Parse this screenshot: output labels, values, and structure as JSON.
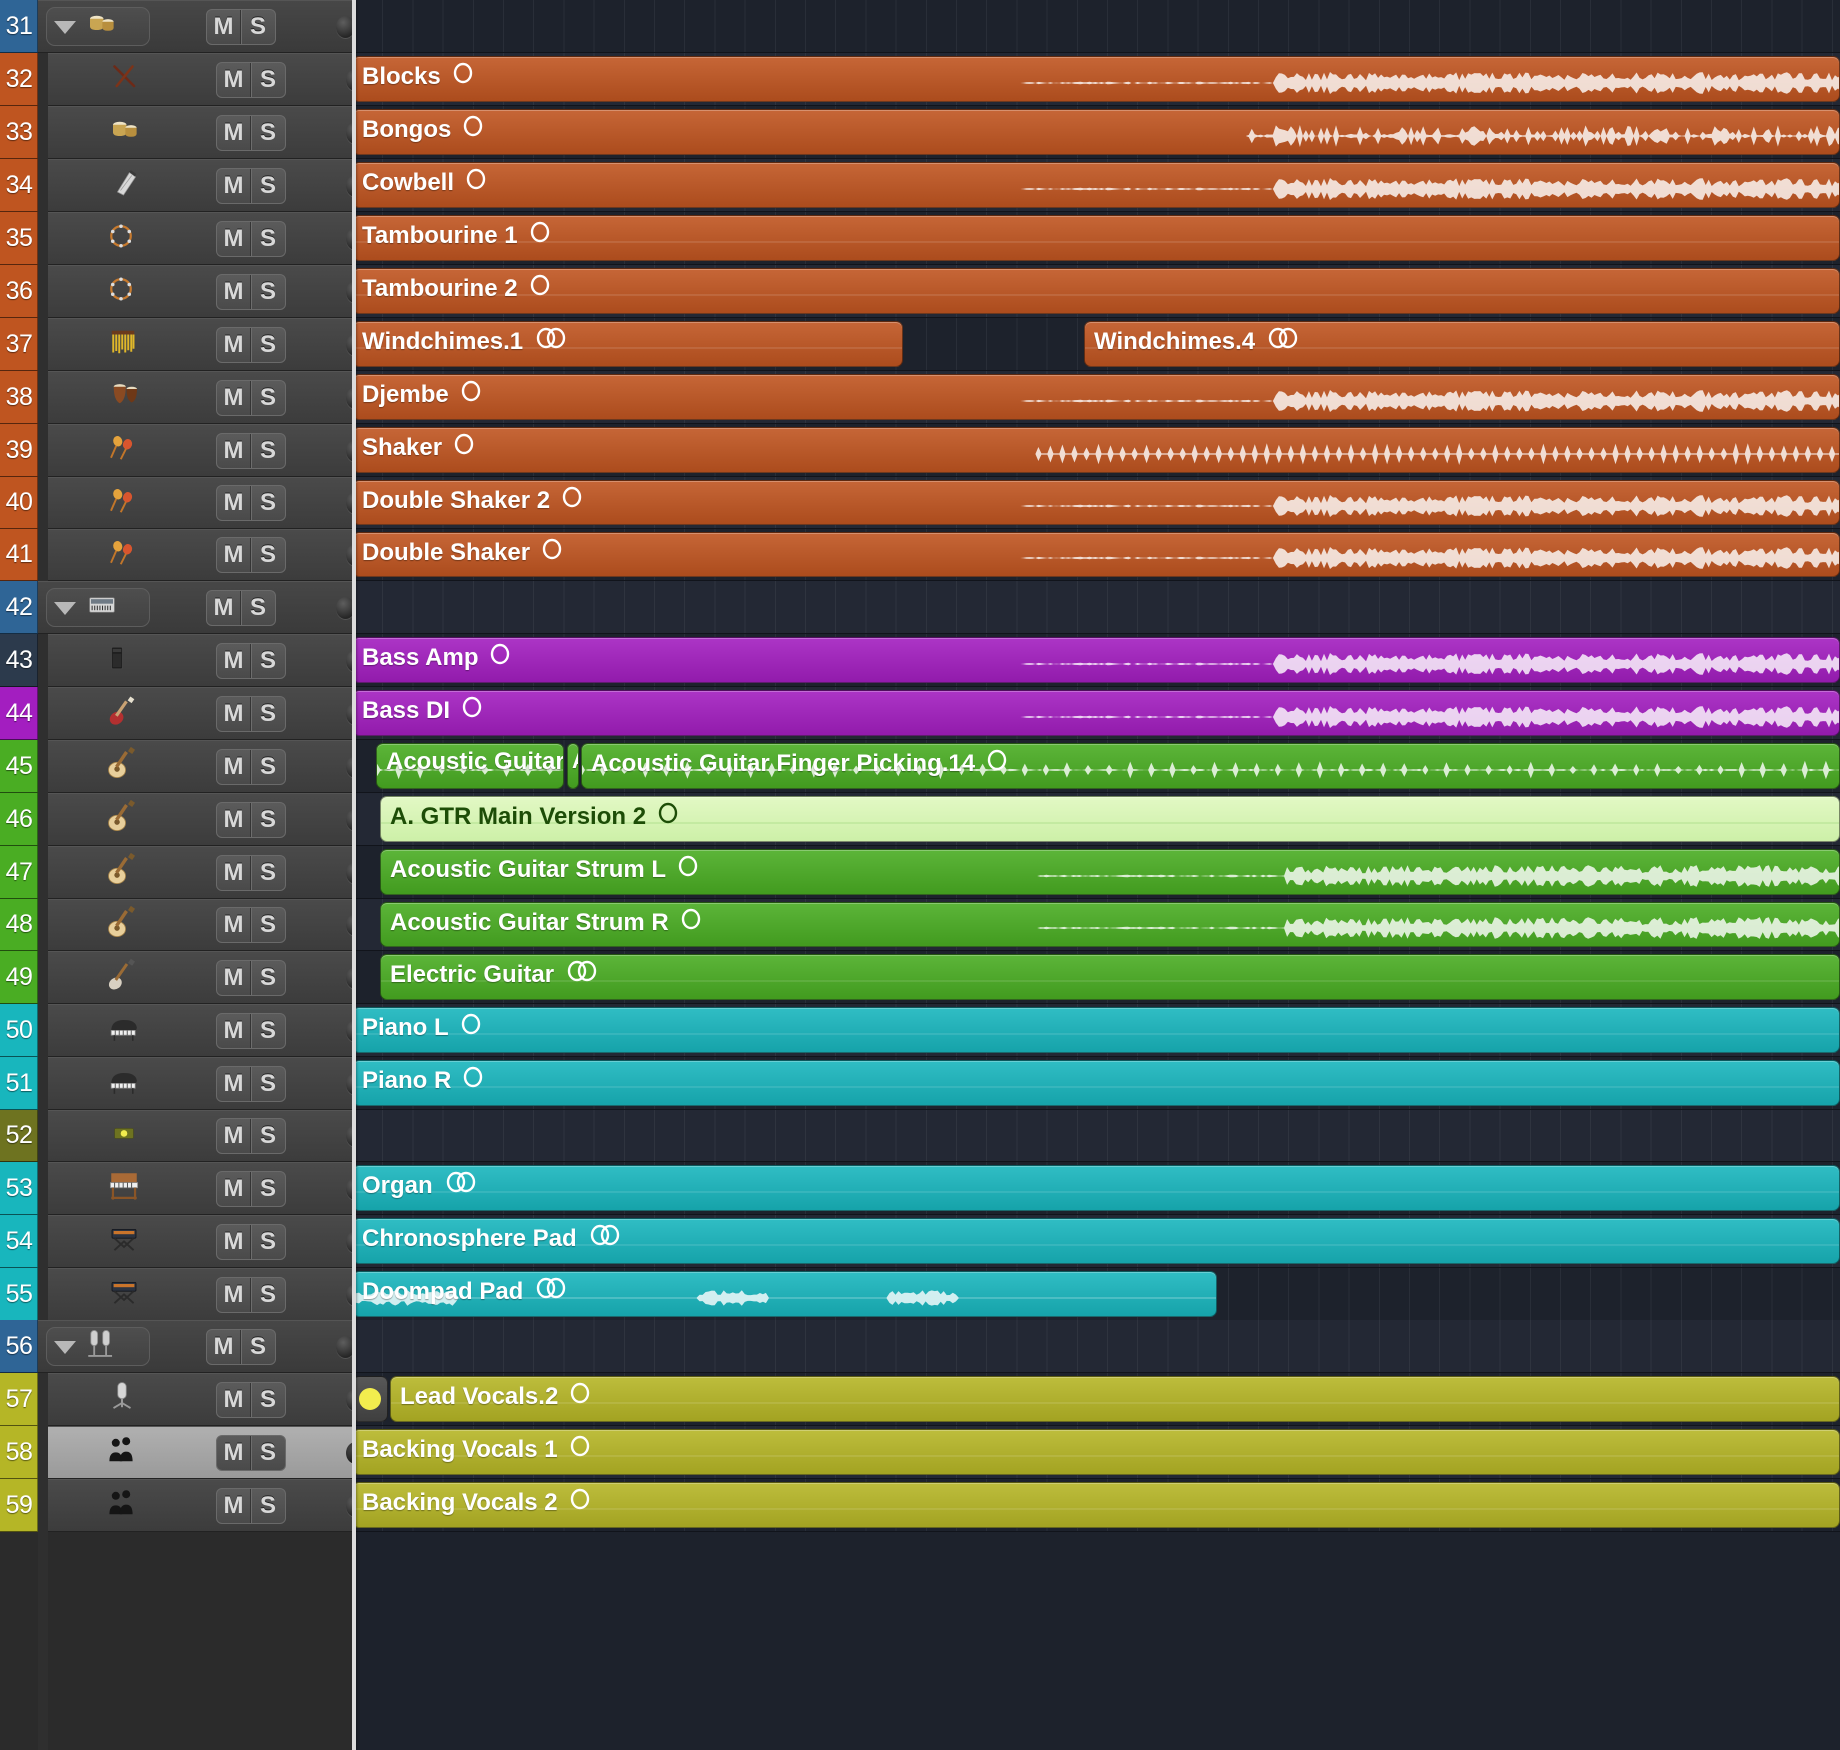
{
  "app": {
    "name": "logic-pro-arrange-window"
  },
  "colors": {
    "percussion": "#bf5520",
    "bass": "#a31ec0",
    "guitar": "#4aad23",
    "guitar_selected": "#cdf0a8",
    "keys": "#18b6bd",
    "vocals": "#b5b626",
    "folder_blue": "#2f6596",
    "folder_navy": "#2c3a4c",
    "olive": "#6e7320",
    "background": "#1d222c",
    "lane_alt": "#232834",
    "playhead": "#dcdcdc"
  },
  "tracklist": {
    "mute_label": "M",
    "solo_label": "S",
    "tracks": [
      {
        "number": "31",
        "num_color": "#2f6596",
        "icon": "bongos-icon",
        "kind": "group",
        "selected": false
      },
      {
        "number": "32",
        "num_color": "#bf5520",
        "icon": "drumsticks-icon",
        "kind": "sub",
        "selected": false
      },
      {
        "number": "33",
        "num_color": "#bf5520",
        "icon": "bongos-icon",
        "kind": "sub",
        "selected": false
      },
      {
        "number": "34",
        "num_color": "#bf5520",
        "icon": "cowbell-icon",
        "kind": "sub",
        "selected": false
      },
      {
        "number": "35",
        "num_color": "#bf5520",
        "icon": "tambourine-icon",
        "kind": "sub",
        "selected": false
      },
      {
        "number": "36",
        "num_color": "#bf5520",
        "icon": "tambourine-icon",
        "kind": "sub",
        "selected": false
      },
      {
        "number": "37",
        "num_color": "#bf5520",
        "icon": "windchimes-icon",
        "kind": "sub",
        "selected": false
      },
      {
        "number": "38",
        "num_color": "#bf5520",
        "icon": "djembe-icon",
        "kind": "sub",
        "selected": false
      },
      {
        "number": "39",
        "num_color": "#bf5520",
        "icon": "maracas-icon",
        "kind": "sub",
        "selected": false
      },
      {
        "number": "40",
        "num_color": "#bf5520",
        "icon": "maracas-icon",
        "kind": "sub",
        "selected": false
      },
      {
        "number": "41",
        "num_color": "#bf5520",
        "icon": "maracas-icon",
        "kind": "sub",
        "selected": false
      },
      {
        "number": "42",
        "num_color": "#2f6596",
        "icon": "keyboard-icon",
        "kind": "group",
        "selected": false
      },
      {
        "number": "43",
        "num_color": "#2c3a4c",
        "icon": "bass-amp-icon",
        "kind": "sub",
        "selected": false
      },
      {
        "number": "44",
        "num_color": "#a31ec0",
        "icon": "bass-guitar-icon",
        "kind": "sub",
        "selected": false
      },
      {
        "number": "45",
        "num_color": "#4aad23",
        "icon": "acoustic-guitar-icon",
        "kind": "sub",
        "selected": false
      },
      {
        "number": "46",
        "num_color": "#4aad23",
        "icon": "acoustic-guitar-icon",
        "kind": "sub",
        "selected": false
      },
      {
        "number": "47",
        "num_color": "#4aad23",
        "icon": "acoustic-guitar-icon",
        "kind": "sub",
        "selected": false
      },
      {
        "number": "48",
        "num_color": "#4aad23",
        "icon": "acoustic-guitar-icon",
        "kind": "sub",
        "selected": false
      },
      {
        "number": "49",
        "num_color": "#4aad23",
        "icon": "electric-guitar-icon",
        "kind": "sub",
        "selected": false
      },
      {
        "number": "50",
        "num_color": "#18b6bd",
        "icon": "grand-piano-icon",
        "kind": "sub",
        "selected": false
      },
      {
        "number": "51",
        "num_color": "#18b6bd",
        "icon": "grand-piano-icon",
        "kind": "sub",
        "selected": false
      },
      {
        "number": "52",
        "num_color": "#6e7320",
        "icon": "mellotron-icon",
        "kind": "sub",
        "selected": false
      },
      {
        "number": "53",
        "num_color": "#18b6bd",
        "icon": "organ-icon",
        "kind": "sub",
        "selected": false
      },
      {
        "number": "54",
        "num_color": "#18b6bd",
        "icon": "synth-stand-icon",
        "kind": "sub",
        "selected": false
      },
      {
        "number": "55",
        "num_color": "#18b6bd",
        "icon": "synth-stand-icon",
        "kind": "sub",
        "selected": false
      },
      {
        "number": "56",
        "num_color": "#2f6596",
        "icon": "stereo-mic-icon",
        "kind": "group",
        "selected": false
      },
      {
        "number": "57",
        "num_color": "#b5b626",
        "icon": "condenser-mic-icon",
        "kind": "sub",
        "selected": false
      },
      {
        "number": "58",
        "num_color": "#b5b626",
        "icon": "choir-icon",
        "kind": "sub",
        "selected": true
      },
      {
        "number": "59",
        "num_color": "#b5b626",
        "icon": "choir-icon",
        "kind": "sub",
        "selected": false
      }
    ]
  },
  "arrange": {
    "playhead_x": 0,
    "regions": [
      {
        "lane": 1,
        "name": "Blocks",
        "channel": "mono",
        "color": "#bf5520",
        "start": 0,
        "end": 1488,
        "wave": "dense-right",
        "selected": false
      },
      {
        "lane": 2,
        "name": "Bongos",
        "channel": "mono",
        "color": "#bf5520",
        "start": 0,
        "end": 1488,
        "wave": "sparse-right",
        "selected": false
      },
      {
        "lane": 3,
        "name": "Cowbell",
        "channel": "mono",
        "color": "#bf5520",
        "start": 0,
        "end": 1488,
        "wave": "dense-right",
        "selected": false
      },
      {
        "lane": 4,
        "name": "Tambourine 1",
        "channel": "mono",
        "color": "#bf5520",
        "start": 0,
        "end": 1488,
        "wave": "flat",
        "selected": false
      },
      {
        "lane": 5,
        "name": "Tambourine 2",
        "channel": "mono",
        "color": "#bf5520",
        "start": 0,
        "end": 1488,
        "wave": "flat",
        "selected": false
      },
      {
        "lane": 6,
        "name": "Windchimes.1",
        "channel": "stereo",
        "color": "#bf5520",
        "start": 0,
        "end": 551,
        "wave": "flat",
        "selected": false
      },
      {
        "lane": 6,
        "name": "Windchimes.4",
        "channel": "stereo",
        "color": "#bf5520",
        "start": 732,
        "end": 1488,
        "wave": "flat",
        "selected": false
      },
      {
        "lane": 7,
        "name": "Djembe",
        "channel": "mono",
        "color": "#bf5520",
        "start": 0,
        "end": 1488,
        "wave": "dense-right",
        "selected": false
      },
      {
        "lane": 8,
        "name": "Shaker",
        "channel": "mono",
        "color": "#bf5520",
        "start": 0,
        "end": 1488,
        "wave": "ticks-right",
        "selected": false
      },
      {
        "lane": 9,
        "name": "Double Shaker 2",
        "channel": "mono",
        "color": "#bf5520",
        "start": 0,
        "end": 1488,
        "wave": "dense-right",
        "selected": false
      },
      {
        "lane": 10,
        "name": "Double Shaker",
        "channel": "mono",
        "color": "#bf5520",
        "start": 0,
        "end": 1488,
        "wave": "dense-right",
        "selected": false
      },
      {
        "lane": 12,
        "name": "Bass Amp",
        "channel": "mono",
        "color": "#a31ec0",
        "start": 0,
        "end": 1488,
        "wave": "dense-right",
        "selected": false
      },
      {
        "lane": 13,
        "name": "Bass DI",
        "channel": "mono",
        "color": "#a31ec0",
        "start": 0,
        "end": 1488,
        "wave": "dense-right",
        "selected": false
      },
      {
        "lane": 14,
        "name": "Acoustic Guitar Fin",
        "channel": "none",
        "color": "#4aad23",
        "start": 24,
        "end": 212,
        "wave": "acoustic",
        "selected": false
      },
      {
        "lane": 14,
        "name": "A",
        "channel": "none",
        "color": "#4aad23",
        "start": 215,
        "end": 227,
        "wave": "none",
        "selected": false
      },
      {
        "lane": 14,
        "name": "Acoustic Guitar Finger Picking.14",
        "channel": "mono",
        "color": "#4aad23",
        "start": 229,
        "end": 1488,
        "wave": "acoustic",
        "selected": false
      },
      {
        "lane": 15,
        "name": "A. GTR Main Version 2",
        "channel": "mono",
        "color": "#cdf0a8",
        "start": 28,
        "end": 1488,
        "wave": "flat-green",
        "selected": true
      },
      {
        "lane": 16,
        "name": "Acoustic Guitar Strum L",
        "channel": "mono",
        "color": "#4aad23",
        "start": 28,
        "end": 1488,
        "wave": "dense-right",
        "selected": false
      },
      {
        "lane": 17,
        "name": "Acoustic Guitar Strum R",
        "channel": "mono",
        "color": "#4aad23",
        "start": 28,
        "end": 1488,
        "wave": "dense-right",
        "selected": false
      },
      {
        "lane": 18,
        "name": "Electric Guitar",
        "channel": "stereo",
        "color": "#4aad23",
        "start": 28,
        "end": 1488,
        "wave": "flat",
        "selected": false
      },
      {
        "lane": 19,
        "name": "Piano L",
        "channel": "mono",
        "color": "#18b6bd",
        "start": 0,
        "end": 1488,
        "wave": "flat",
        "selected": false
      },
      {
        "lane": 20,
        "name": "Piano R",
        "channel": "mono",
        "color": "#18b6bd",
        "start": 0,
        "end": 1488,
        "wave": "flat",
        "selected": false
      },
      {
        "lane": 22,
        "name": "Organ",
        "channel": "stereo",
        "color": "#18b6bd",
        "start": 0,
        "end": 1488,
        "wave": "flat",
        "selected": false
      },
      {
        "lane": 23,
        "name": "Chronosphere Pad",
        "channel": "stereo",
        "color": "#18b6bd",
        "start": 0,
        "end": 1488,
        "wave": "flat",
        "selected": false
      },
      {
        "lane": 24,
        "name": "Doompad Pad",
        "channel": "stereo",
        "color": "#18b6bd",
        "start": 0,
        "end": 865,
        "wave": "pad",
        "selected": false
      },
      {
        "lane": 26,
        "name": "Lead Vocals.2",
        "channel": "mono",
        "color": "#b5b626",
        "start": 38,
        "end": 1488,
        "wave": "flat",
        "selected": false
      },
      {
        "lane": 27,
        "name": "Backing Vocals 1",
        "channel": "mono",
        "color": "#b5b626",
        "start": 0,
        "end": 1488,
        "wave": "flat",
        "selected": false
      },
      {
        "lane": 28,
        "name": "Backing Vocals 2",
        "channel": "mono",
        "color": "#b5b626",
        "start": 0,
        "end": 1488,
        "wave": "flat",
        "selected": false
      }
    ]
  }
}
